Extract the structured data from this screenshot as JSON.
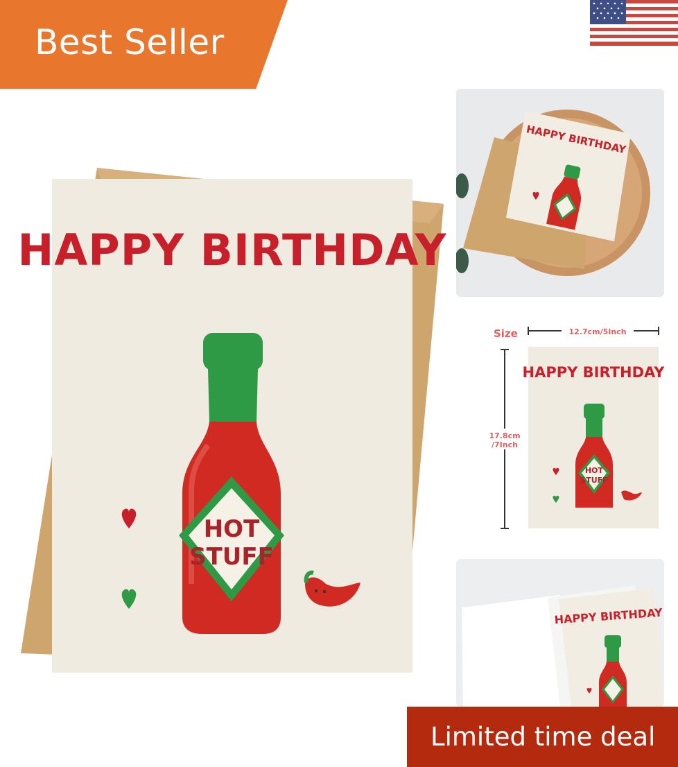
{
  "badges": {
    "best_seller": "Best Seller",
    "limited_deal": "Limited time deal"
  },
  "card": {
    "title": "HAPPY BIRTHDAY",
    "label_line1": "HOT",
    "label_line2": "STUFF"
  },
  "size_chart": {
    "size_label": "Size",
    "width": "12.7cm/5Inch",
    "height_line1": "17.8cm",
    "height_line2": "/7Inch"
  },
  "colors": {
    "badge_orange": "#e8762d",
    "deal_red": "#b42a0f",
    "title_red": "#c8202a",
    "bottle_green": "#2e9a45",
    "card_cream": "#efebe0",
    "envelope_kraft": "#cfa56e"
  },
  "icons": {
    "flag": "us-flag-icon",
    "heart": "heart-icon",
    "pepper": "chili-pepper-icon"
  }
}
